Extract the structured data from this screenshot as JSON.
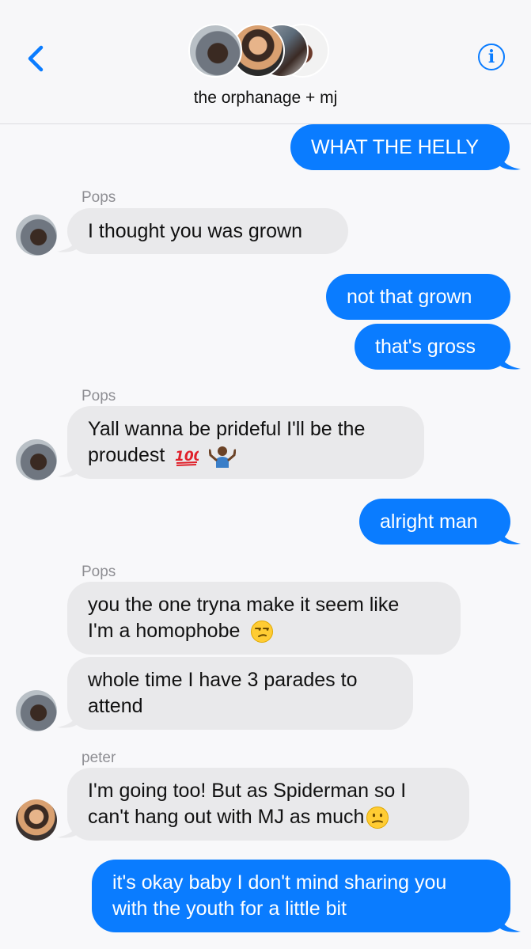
{
  "header": {
    "title": "the orphanage + mj",
    "back_icon": "chevron-left-icon",
    "info_icon": "info-icon",
    "info_glyph": "i",
    "accent": "#0a7cff"
  },
  "messages": [
    {
      "direction": "outgoing",
      "lines": [
        "WHAT THE HELLY"
      ]
    },
    {
      "direction": "incoming",
      "sender": "Pops",
      "lines": [
        "I thought you was grown"
      ]
    },
    {
      "direction": "outgoing",
      "lines": [
        "not that grown"
      ]
    },
    {
      "direction": "outgoing",
      "lines": [
        "that's gross"
      ]
    },
    {
      "direction": "incoming",
      "sender": "Pops",
      "lines": [
        "Yall wanna be prideful I'll be the",
        "proudest"
      ],
      "emoji": [
        "hundred-points-emoji",
        "shrug-emoji"
      ]
    },
    {
      "direction": "outgoing",
      "lines": [
        "alright man"
      ]
    },
    {
      "direction": "incoming",
      "sender": "Pops",
      "lines": [
        "you the one tryna make it seem like",
        "I'm a homophobe"
      ],
      "emoji": [
        "unamused-face-emoji"
      ]
    },
    {
      "direction": "incoming",
      "lines": [
        "whole time I have 3 parades to",
        "attend"
      ]
    },
    {
      "direction": "incoming",
      "sender": "peter",
      "lines": [
        "I'm going too! But as Spiderman so I",
        "can't hang out with MJ as much"
      ],
      "emoji": [
        "confused-face-emoji"
      ]
    },
    {
      "direction": "outgoing",
      "lines": [
        "it's okay baby I don't mind sharing you",
        "with the youth for a little bit"
      ]
    }
  ],
  "colors": {
    "outgoing_bubble": "#0a7cff",
    "incoming_bubble": "#e9e9eb",
    "sender_label": "#8e8e93",
    "background": "#f8f8fa"
  }
}
